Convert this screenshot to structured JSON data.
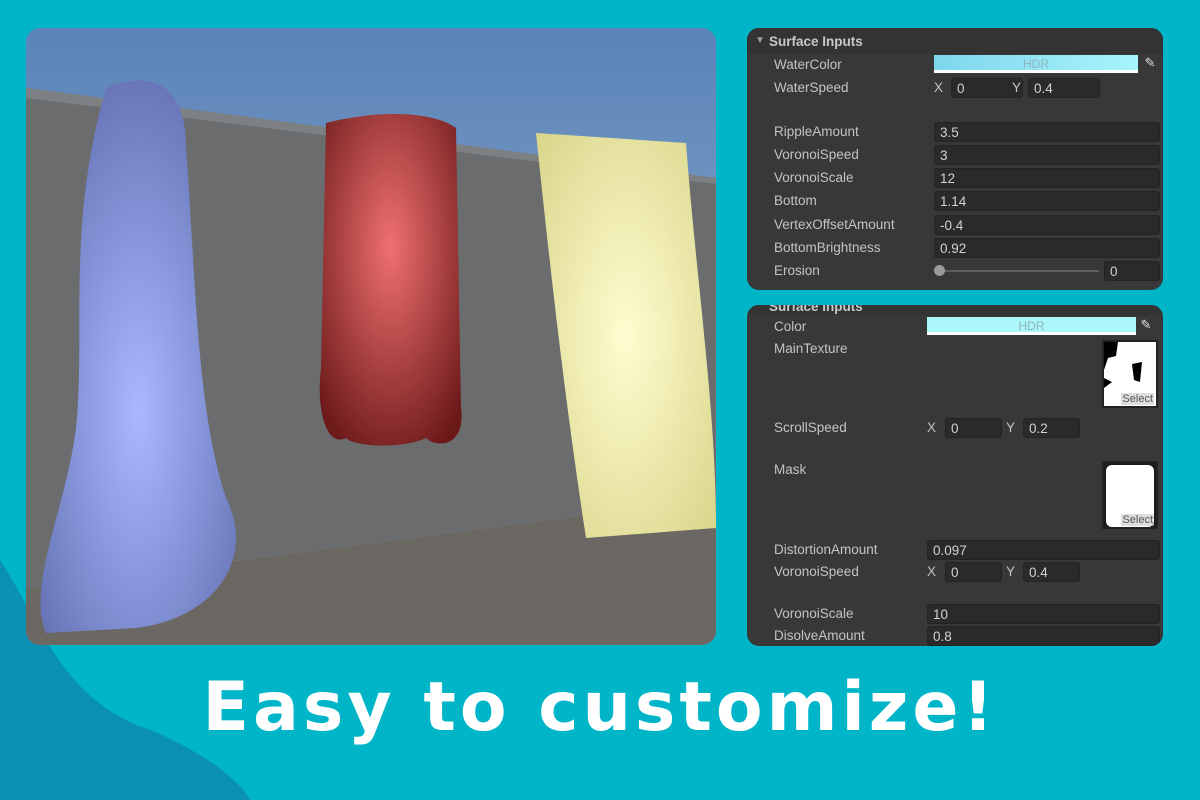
{
  "headline": "Easy to customize!",
  "colors": {
    "background": "#00b5c8",
    "wave": "#0a8fb5",
    "panel": "#383838"
  },
  "panel_water": {
    "header": "Surface Inputs",
    "water_color": {
      "label": "WaterColor",
      "bar_text": "HDR"
    },
    "water_speed": {
      "label": "WaterSpeed",
      "x_label": "X",
      "x": "0",
      "y_label": "Y",
      "y": "0.4"
    },
    "ripple_amount": {
      "label": "RippleAmount",
      "value": "3.5"
    },
    "voronoi_speed": {
      "label": "VoronoiSpeed",
      "value": "3"
    },
    "voronoi_scale": {
      "label": "VoronoiScale",
      "value": "12"
    },
    "bottom": {
      "label": "Bottom",
      "value": "1.14"
    },
    "vertex_offset": {
      "label": "VertexOffsetAmount",
      "value": "-0.4"
    },
    "bottom_brightness": {
      "label": "BottomBrightness",
      "value": "0.92"
    },
    "erosion": {
      "label": "Erosion",
      "value": "0",
      "slider_fraction": 0
    }
  },
  "panel_fire": {
    "header": "Surface Inputs",
    "color": {
      "label": "Color",
      "bar_text": "HDR"
    },
    "main_texture": {
      "label": "MainTexture",
      "select": "Select"
    },
    "scroll_speed": {
      "label": "ScrollSpeed",
      "x_label": "X",
      "x": "0",
      "y_label": "Y",
      "y": "0.2"
    },
    "mask": {
      "label": "Mask",
      "select": "Select"
    },
    "distortion": {
      "label": "DistortionAmount",
      "value": "0.097"
    },
    "voronoi_speed": {
      "label": "VoronoiSpeed",
      "x_label": "X",
      "x": "0",
      "y_label": "Y",
      "y": "0.4"
    },
    "voronoi_scale": {
      "label": "VoronoiScale",
      "value": "10"
    },
    "dissolve": {
      "label": "DisolveAmount",
      "value": "0.8"
    }
  }
}
